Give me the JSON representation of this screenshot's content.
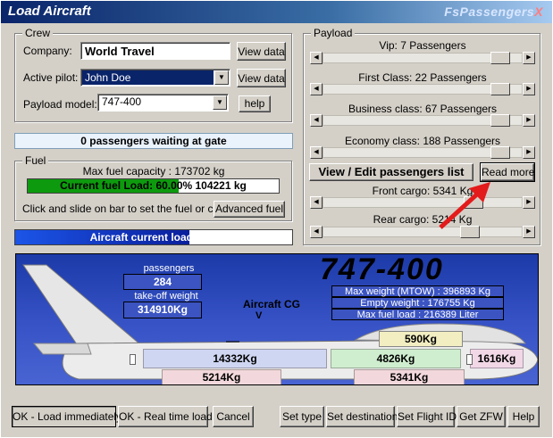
{
  "window": {
    "title": "Load Aircraft",
    "brand_main": "FsPassengers",
    "brand_suffix": "X"
  },
  "crew": {
    "group_label": "Crew",
    "company_label": "Company:",
    "company_value": "World Travel",
    "company_view": "View data",
    "pilot_label": "Active pilot:",
    "pilot_value": "John Doe",
    "pilot_view": "View data",
    "model_label": "Payload model:",
    "model_value": "747-400",
    "help": "help"
  },
  "gate_status": "0 passengers waiting at gate",
  "fuel": {
    "group_label": "Fuel",
    "max_capacity": "Max fuel capacity : 173702 kg",
    "current_load": "Current fuel Load: 60.00%  104221 kg",
    "current_percent": 60,
    "instructions": "Click and slide on bar to set the fuel or click :",
    "advanced": "Advanced fuel"
  },
  "aircraft_load": {
    "text": "Aircraft current load 63%",
    "percent": 63
  },
  "payload": {
    "group_label": "Payload",
    "sliders": [
      {
        "caption": "Vip: 7 Passengers",
        "value": 0.93
      },
      {
        "caption": "First Class: 22 Passengers",
        "value": 0.93
      },
      {
        "caption": "Business class: 67 Passengers",
        "value": 0.93
      },
      {
        "caption": "Economy class: 188 Passengers",
        "value": 0.93
      }
    ],
    "view_edit": "View / Edit passengers list",
    "read_more": "Read more",
    "cargo": [
      {
        "caption": "Front cargo: 5341 Kg",
        "value": 0.78
      },
      {
        "caption": "Rear cargo: 5214 Kg",
        "value": 0.76
      }
    ]
  },
  "diagram": {
    "model_title": "747-400",
    "passengers_label": "passengers",
    "passengers_value": "284",
    "takeoff_label": "take-off weight",
    "takeoff_value": "314910Kg",
    "cg_label": "Aircraft CG",
    "cg_marker": "V",
    "max_weight": "Max weight (MTOW) : 396893 Kg",
    "empty_weight": "Empty weight : 176755 Kg",
    "max_fuel": "Max fuel load : 216389 Liter",
    "zones": {
      "fwd_cabin": "14332Kg",
      "mid_cabin": "4826Kg",
      "upper_deck": "590Kg",
      "nose": "1616Kg",
      "rear_cargo": "5214Kg",
      "front_cargo": "5341Kg"
    }
  },
  "buttons": {
    "load_immediately": "OK - Load immediately",
    "real_time": "OK - Real time load",
    "cancel": "Cancel",
    "set_type": "Set type",
    "set_destination": "Set destination",
    "set_flight_id": "Set Flight ID",
    "get_zfw": "Get ZFW",
    "help": "Help"
  },
  "colors": {
    "accent_green": "#0e9a0e",
    "load_bar": "#0a2a9c",
    "arrow": "#e31b1b"
  },
  "icons": {
    "dropdown": "chevron-down-icon",
    "slider_left": "arrow-left-icon",
    "slider_right": "arrow-right-icon"
  }
}
